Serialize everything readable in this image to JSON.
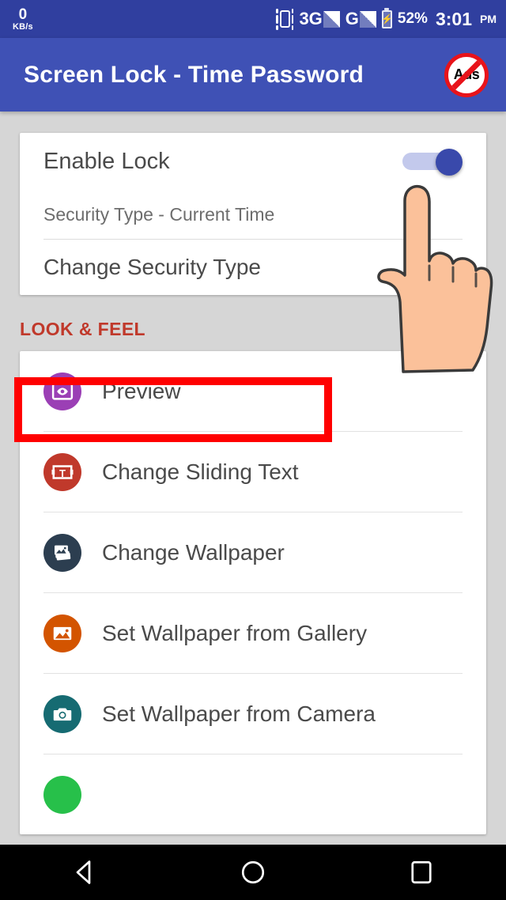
{
  "status_bar": {
    "net_speed_value": "0",
    "net_speed_unit": "KB/s",
    "vibrate_icon": "vibrate-icon",
    "network_1": "3G",
    "network_2": "G",
    "battery_percent": "52%",
    "battery_icon": "battery-charging-icon",
    "time": "3:01",
    "ampm": "PM",
    "background_color": "#303f9f"
  },
  "app_bar": {
    "title": "Screen Lock - Time Password",
    "no_ads_label": "Ads",
    "no_ads_icon": "no-ads-icon",
    "background_color": "#3f51b5"
  },
  "settings_card": {
    "enable_lock_label": "Enable Lock",
    "enable_lock_toggle_state": "on",
    "security_type_label": "Security Type - Current Time",
    "change_security_type_label": "Change Security Type"
  },
  "annotation": {
    "highlight_color": "#ff0000",
    "highlight_target": "Change Security Type",
    "pointer_icon": "pointing-hand-icon"
  },
  "look_and_feel": {
    "section_title": "LOOK & FEEL",
    "section_title_color": "#c0392b",
    "items": [
      {
        "label": "Preview",
        "icon": "eye-preview-icon",
        "color": "#9b3fb5"
      },
      {
        "label": "Change Sliding Text",
        "icon": "text-format-icon",
        "color": "#c0392b"
      },
      {
        "label": "Change Wallpaper",
        "icon": "stacked-photos-icon",
        "color": "#2c3e50"
      },
      {
        "label": "Set Wallpaper from Gallery",
        "icon": "gallery-image-icon",
        "color": "#d35400"
      },
      {
        "label": "Set Wallpaper from Camera",
        "icon": "camera-icon",
        "color": "#166b72"
      },
      {
        "label": "",
        "icon": "green-circle-icon",
        "color": "#27c04a"
      }
    ]
  },
  "nav_bar": {
    "back_icon": "back-triangle-icon",
    "home_icon": "home-circle-icon",
    "recents_icon": "recents-square-icon",
    "background_color": "#000000"
  }
}
